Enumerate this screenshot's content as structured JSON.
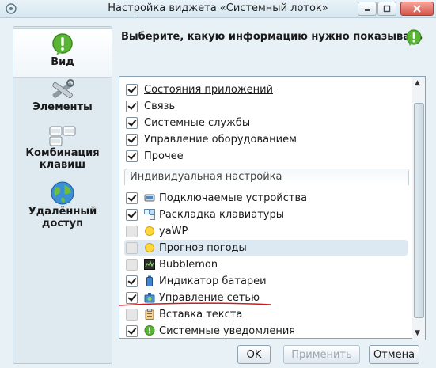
{
  "window": {
    "title": "Настройка виджета «Системный лоток»",
    "controls": [
      "minimize-icon",
      "maximize-icon",
      "close-icon"
    ]
  },
  "sidebar": {
    "items": [
      {
        "label": "Вид",
        "icon": "exclamation-bubble-icon",
        "active": true
      },
      {
        "label": "Элементы",
        "icon": "tools-icon",
        "active": false
      },
      {
        "label": "Комбинация клавиш",
        "icon": "keyboard-icon",
        "active": false
      },
      {
        "label": "Удалённый доступ",
        "icon": "globe-icon",
        "active": false
      }
    ]
  },
  "main": {
    "heading": "Выберите, какую информацию нужно показывать",
    "heading_icon": "exclamation-bubble-icon",
    "categories": [
      {
        "label": "Состояния приложений",
        "checked": true,
        "underlined": true
      },
      {
        "label": "Связь",
        "checked": true
      },
      {
        "label": "Системные службы",
        "checked": true
      },
      {
        "label": "Управление оборудованием",
        "checked": true
      },
      {
        "label": "Прочее",
        "checked": true
      }
    ],
    "group_title": "Индивидуальная настройка",
    "individual": [
      {
        "label": "Подключаемые устройства",
        "checked": true,
        "icon": "device-icon"
      },
      {
        "label": "Раскладка клавиатуры",
        "checked": true,
        "icon": "keyboard-layout-icon"
      },
      {
        "label": "yaWP",
        "checked": false,
        "icon": "sun-icon"
      },
      {
        "label": "Прогноз погоды",
        "checked": false,
        "icon": "sun-icon",
        "highlighted": true
      },
      {
        "label": "Bubblemon",
        "checked": false,
        "icon": "monitor-icon"
      },
      {
        "label": "Индикатор батареи",
        "checked": true,
        "icon": "battery-icon"
      },
      {
        "label": "Управление сетью",
        "checked": true,
        "icon": "network-icon"
      },
      {
        "label": "Вставка текста",
        "checked": false,
        "icon": "clipboard-icon"
      },
      {
        "label": "Системные уведомления",
        "checked": true,
        "icon": "exclamation-bubble-icon"
      }
    ]
  },
  "footer": {
    "ok": "OK",
    "apply": "Применить",
    "cancel": "Отмена"
  },
  "colors": {
    "window_bg": "#e8f1f6",
    "annotation_line": "#d11a1a",
    "accent_green": "#4fae2f"
  }
}
